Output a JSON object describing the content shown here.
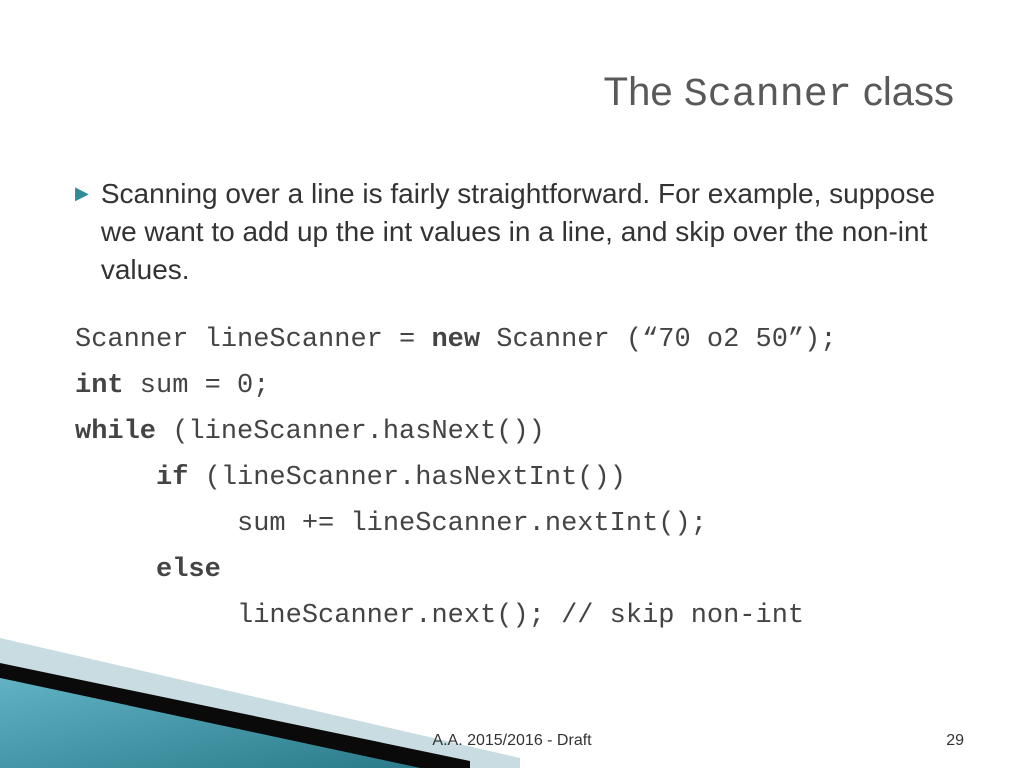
{
  "title": {
    "prefix": "The ",
    "code": "Scanner",
    "suffix": " class"
  },
  "bullet": "Scanning over a line is fairly straightforward.  For example, suppose we want to add up the int values in a line, and skip over the non-int values.",
  "code": {
    "line1_a": "Scanner lineScanner = ",
    "line1_kw": "new",
    "line1_b": " Scanner (“70 o2 50”);",
    "line2_kw": "int",
    "line2_b": " sum = 0;",
    "line3_kw": "while",
    "line3_b": " (lineScanner.hasNext())",
    "line4_pad": "     ",
    "line4_kw": "if",
    "line4_b": " (lineScanner.hasNextInt())",
    "line5": "          sum += lineScanner.nextInt();",
    "line6_pad": "     ",
    "line6_kw": "else",
    "line7": "          lineScanner.next(); // skip non-int"
  },
  "footer": "A.A. 2015/2016  -  Draft",
  "page": "29"
}
